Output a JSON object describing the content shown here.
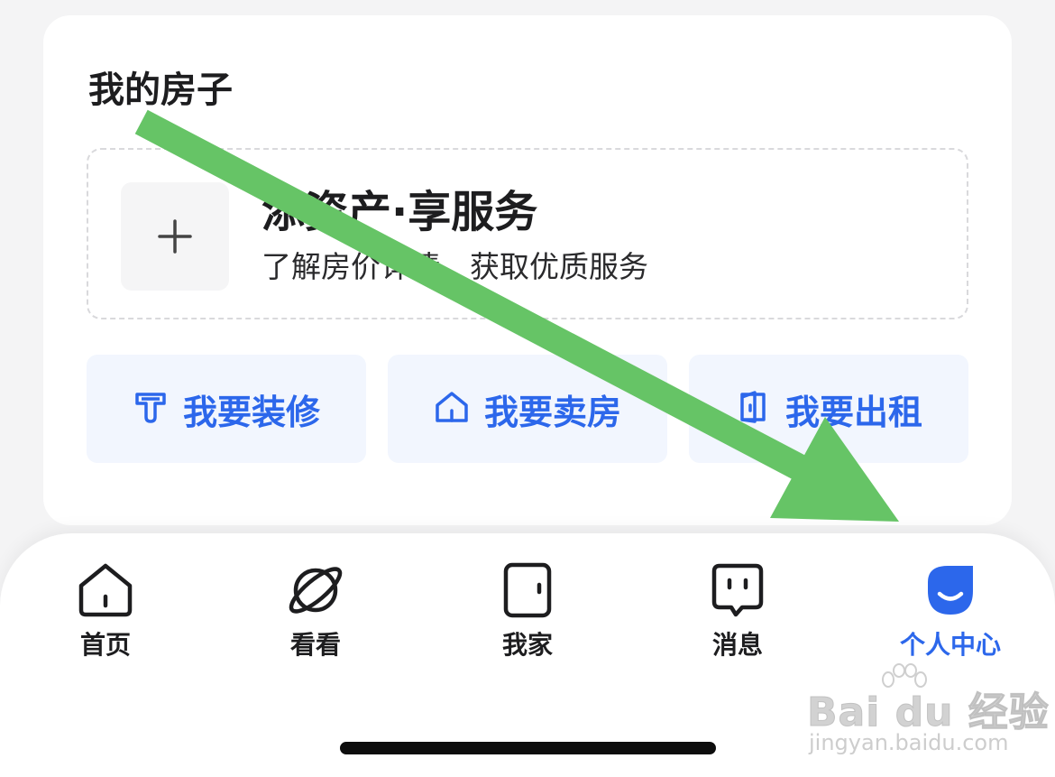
{
  "my_house": {
    "title": "我的房子",
    "add_asset": {
      "title": "添资产·享服务",
      "subtitle": "了解房价详情，获取优质服务"
    },
    "actions": [
      {
        "label": "我要装修",
        "icon": "renovate-icon"
      },
      {
        "label": "我要卖房",
        "icon": "house-icon"
      },
      {
        "label": "我要出租",
        "icon": "door-open-icon"
      }
    ]
  },
  "tabbar": {
    "tabs": [
      {
        "label": "首页",
        "icon": "home-icon",
        "active": false
      },
      {
        "label": "看看",
        "icon": "planet-icon",
        "active": false
      },
      {
        "label": "我家",
        "icon": "door-icon",
        "active": false
      },
      {
        "label": "消息",
        "icon": "message-icon",
        "active": false
      },
      {
        "label": "个人中心",
        "icon": "profile-smile-icon",
        "active": true
      }
    ]
  },
  "watermark": {
    "brand": "Bai du 经验",
    "url": "jingyan.baidu.com"
  },
  "colors": {
    "accent": "#2c67eb",
    "action_bg": "#f2f6fe",
    "arrow": "#66c466"
  }
}
